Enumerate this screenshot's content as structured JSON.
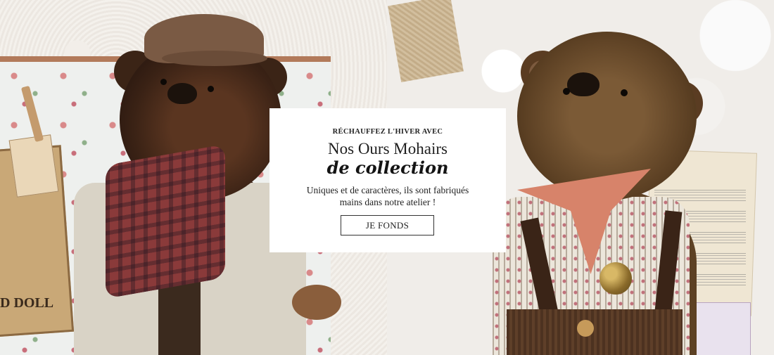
{
  "promo": {
    "eyebrow": "RÉCHAUFFEZ L'HIVER AVEC",
    "title": "Nos Ours Mohairs",
    "title_emphasis": "de collection",
    "body": "Uniques et de caractères, ils sont fabriqués mains dans notre atelier !",
    "cta_label": "JE FONDS"
  },
  "photo_left": {
    "crate_text": "D DOLL"
  },
  "colors": {
    "card_bg": "#ffffff",
    "text": "#222222",
    "button_border": "#333333"
  }
}
